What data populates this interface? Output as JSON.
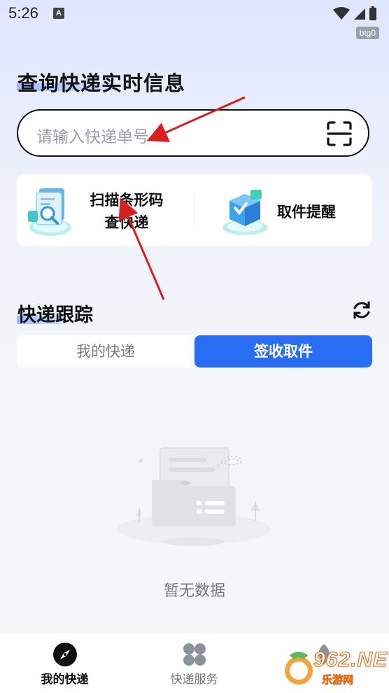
{
  "status_bar": {
    "time": "5:26",
    "notification_badge": "A",
    "device_tag": "btg0"
  },
  "header": {
    "title": "查询快递实时信息"
  },
  "search": {
    "placeholder": "请输入快递单号",
    "scan_icon": "scan-icon"
  },
  "services": [
    {
      "label_line1": "扫描条形码",
      "label_line2": "查快递",
      "icon": "scan-document-icon"
    },
    {
      "label": "取件提醒",
      "icon": "package-box-icon"
    }
  ],
  "tracking": {
    "title": "快递跟踪",
    "refresh_icon": "refresh-icon",
    "tabs": [
      {
        "label": "我的快递",
        "active": false
      },
      {
        "label": "签收取件",
        "active": true
      }
    ],
    "empty_text": "暂无数据"
  },
  "bottom_nav": [
    {
      "label": "我的快递",
      "icon": "compass-icon",
      "active": true
    },
    {
      "label": "快递服务",
      "icon": "grid-icon",
      "active": false
    },
    {
      "label": "",
      "icon": "leaf-icon",
      "active": false
    }
  ],
  "watermark": {
    "text": "962.NET",
    "subtext": "乐游网"
  },
  "colors": {
    "accent": "#2a6df5",
    "annotation_arrow": "#d61f1f",
    "highlight": "#9fb7ff"
  }
}
